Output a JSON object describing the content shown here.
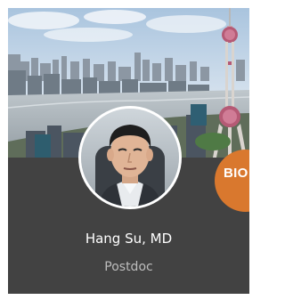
{
  "profile": {
    "name": "Hang Su, MD",
    "role": "Postdoc",
    "badge_label": "BIO"
  },
  "colors": {
    "card_background": "#424242",
    "badge": "#d9782e",
    "name_text": "#ffffff",
    "role_text": "#bdbdbd"
  }
}
